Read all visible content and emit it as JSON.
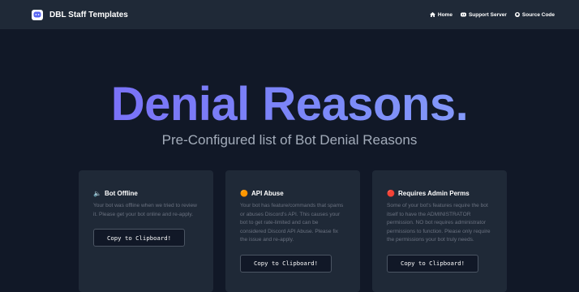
{
  "navbar": {
    "brand_title": "DBL Staff Templates",
    "links": [
      {
        "label": "Home",
        "icon": "home-icon"
      },
      {
        "label": "Support Server",
        "icon": "discord-icon"
      },
      {
        "label": "Source Code",
        "icon": "github-icon"
      }
    ]
  },
  "hero": {
    "title": "Denial Reasons.",
    "subtitle": "Pre-Configured list of Bot Denial Reasons"
  },
  "cards": [
    {
      "icon": "🔈",
      "title": "Bot Offline",
      "text": "Your bot was offline when we tried to review it. Please get your bot online and re-apply.",
      "button": "Copy to Clipboard!"
    },
    {
      "icon": "🟠",
      "title": "API Abuse",
      "text": "Your bot has feature/commands that spams or abuses Discord's API. This causes your bot to get rate-limited and can be considered Discord API Abuse. Please fix the issue and re-apply.",
      "button": "Copy to Clipboard!"
    },
    {
      "icon": "🔴",
      "title": "Requires Admin Perms",
      "text": "Some of your bot's features require the bot itself to have the ADMINISTRATOR permission. NO bot requires administrator permissions to function. Please only require the permissions your bot truly needs.",
      "button": "Copy to Clipboard!"
    }
  ],
  "colors": {
    "background": "#111827",
    "navbar": "#1f2937",
    "card": "#1f2937",
    "accent_gradient_start": "#7a66f7",
    "accent_gradient_end": "#8aa6fb"
  }
}
